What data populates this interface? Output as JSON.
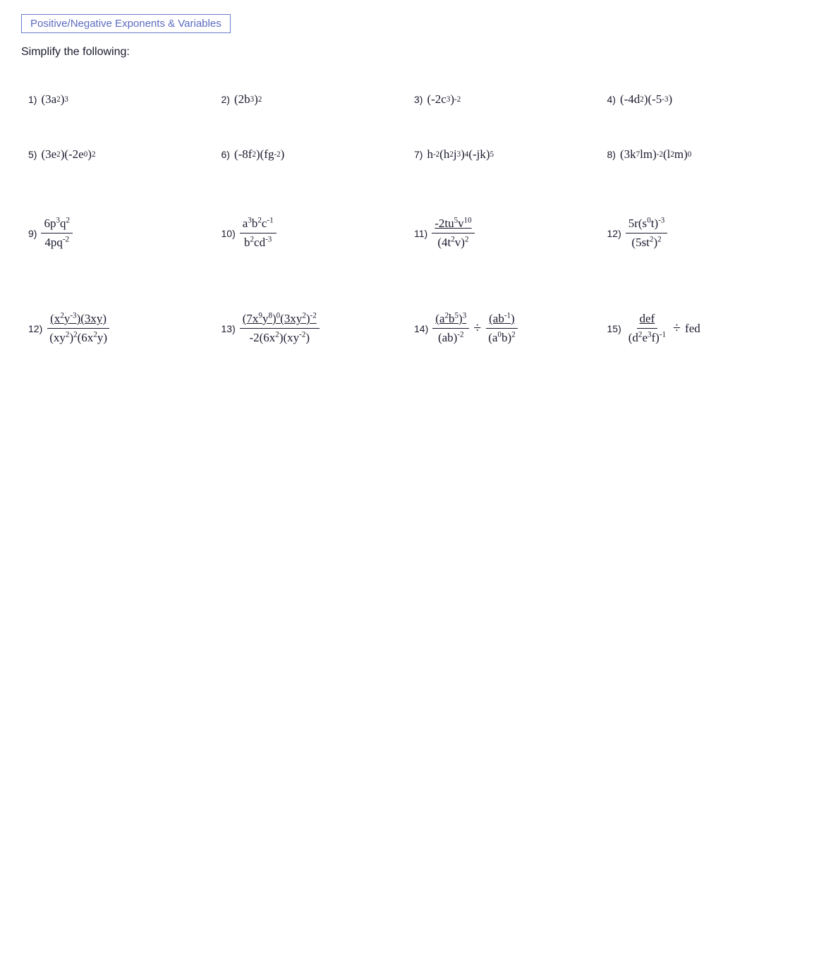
{
  "title": "Positive/Negative Exponents & Variables",
  "instruction": "Simplify the following:",
  "problems": [
    {
      "num": "1)",
      "expr_html": "(3a<sup>2</sup>)<sup>3</sup>"
    },
    {
      "num": "2)",
      "expr_html": "(2b<sup>3</sup>)<sup>2</sup>"
    },
    {
      "num": "3)",
      "expr_html": "(-2c<sup>3</sup>)<sup>-2</sup>"
    },
    {
      "num": "4)",
      "expr_html": "(-4d<sup>2</sup>)(-5<sup>-3</sup>)"
    },
    {
      "num": "5)",
      "expr_html": "(3e<sup>2</sup>)(-2e<sup>0</sup>)<sup>2</sup>"
    },
    {
      "num": "6)",
      "expr_html": "(-8f<sup>2</sup>)(fg<sup>-2</sup>)"
    },
    {
      "num": "7)",
      "expr_html": "h<sup>-2</sup>(h<sup>2</sup>j<sup>3</sup>)<sup>4</sup>(-jk)<sup>5</sup>"
    },
    {
      "num": "8)",
      "expr_html": "(3k<sup>7</sup>lm)<sup>-2</sup>(l<sup>2</sup>m)<sup>0</sup>"
    },
    {
      "num": "9)",
      "frac": true,
      "numer": "6p<sup>3</sup>q<sup>2</sup>",
      "denom": "4pq<sup>-2</sup>"
    },
    {
      "num": "10)",
      "frac": true,
      "numer": "a<sup>3</sup>b<sup>2</sup>c<sup>-1</sup>",
      "denom": "b<sup>2</sup>cd<sup>-3</sup>"
    },
    {
      "num": "11)",
      "frac": true,
      "numer": "<span style='text-decoration:underline'>-2tu<sup>5</sup>v<sup>10</sup></span>",
      "denom": "(4t<sup>2</sup>v)<sup>2</sup>",
      "numer_underline": true
    },
    {
      "num": "12)",
      "frac": true,
      "numer": "5r(s<sup>0</sup>t)<sup>-3</sup>",
      "denom": "(5st<sup>2</sup>)<sup>2</sup>"
    },
    {
      "num": "12)",
      "frac": true,
      "numer": "(x<sup>2</sup>y<sup>-3</sup>)(3xy)",
      "denom": "(xy<sup>2</sup>)<sup>2</sup>(6x<sup>2</sup>y)",
      "numer_underline": true
    },
    {
      "num": "13)",
      "frac": true,
      "numer": "(7x<sup>9</sup>y<sup>8</sup>)<sup>0</sup>(3xy<sup>2</sup>)<sup>-2</sup>",
      "denom": "-2(6x<sup>2</sup>)(xy<sup>-2</sup>)",
      "numer_underline": true
    },
    {
      "num": "14)",
      "complex": true
    },
    {
      "num": "15)",
      "complex2": true
    }
  ]
}
